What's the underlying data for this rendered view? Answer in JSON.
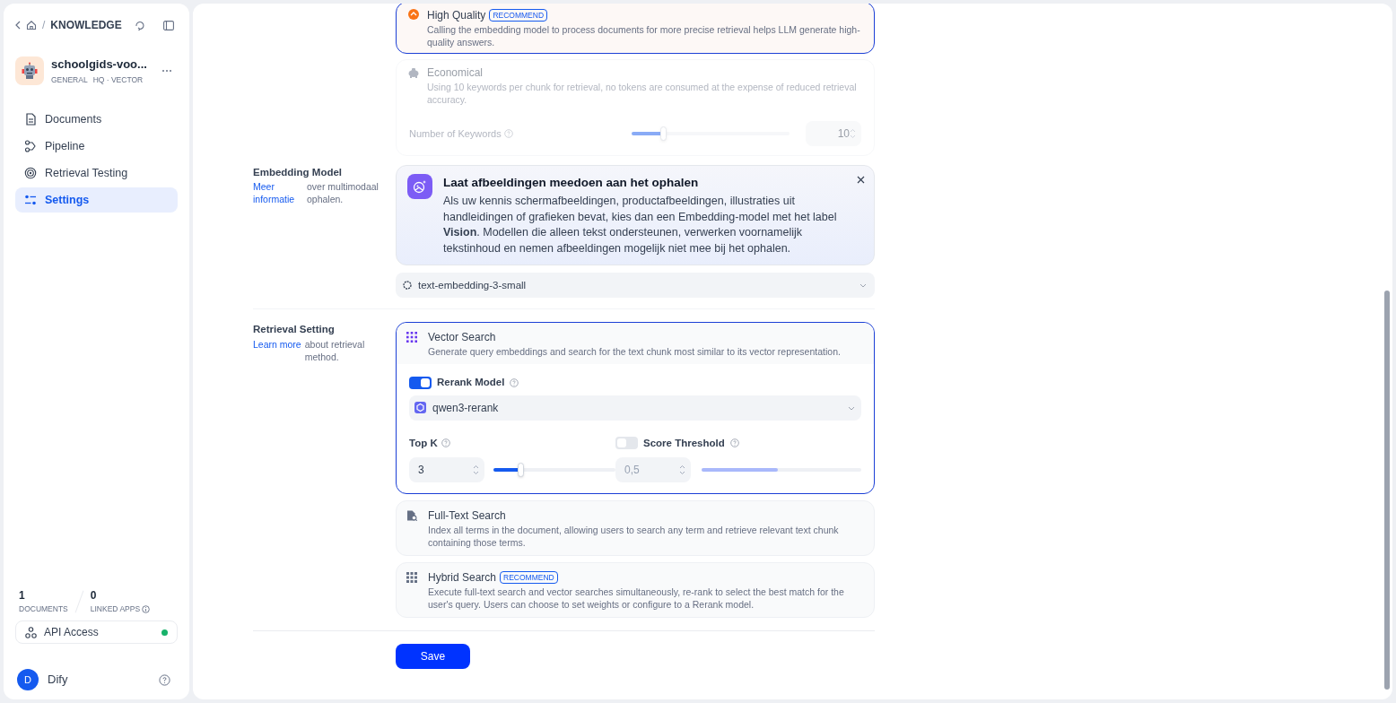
{
  "breadcrumb": {
    "separator": "/",
    "section": "KNOWLEDGE"
  },
  "dataset": {
    "name": "schoolgids-voo...",
    "tags": [
      "GENERAL",
      "HQ · VECTOR"
    ]
  },
  "nav": [
    {
      "kind": "documents",
      "label": "Documents",
      "selected": false
    },
    {
      "kind": "pipeline",
      "label": "Pipeline",
      "selected": false
    },
    {
      "kind": "testing",
      "label": "Retrieval Testing",
      "selected": false
    },
    {
      "kind": "settings",
      "label": "Settings",
      "selected": true
    }
  ],
  "stats": [
    {
      "value": "1",
      "label": "DOCUMENTS",
      "info": false
    },
    {
      "value": "0",
      "label": "LINKED APPS",
      "info": true
    }
  ],
  "api_access": {
    "label": "API Access",
    "on": true
  },
  "user": {
    "initial": "D",
    "name": "Dify"
  },
  "index_method": {
    "options": [
      {
        "kind": "high",
        "title": "High Quality",
        "badge": "RECOMMEND",
        "description": "Calling the embedding model to process documents for more precise retrieval helps LLM generate high-quality answers.",
        "selected": true
      },
      {
        "kind": "economical",
        "title": "Economical",
        "description": "Using 10 keywords per chunk for retrieval, no tokens are consumed at the expense of reduced retrieval accuracy.",
        "selected": false
      }
    ],
    "keywords": {
      "label": "Number of Keywords",
      "value": "10",
      "level": 0.2
    }
  },
  "embedding_model": {
    "label": "Embedding Model",
    "link": "Meer informatie",
    "note": "over multimodaal ophalen.",
    "banner": {
      "title": "Laat afbeeldingen meedoen aan het ophalen",
      "text": "Als uw kennis schermafbeeldingen, productafbeeldingen, illustraties uit handleidingen of grafieken bevat, kies dan een Embedding-model met het label **Vision**. Modellen die alleen tekst ondersteunen, verwerken voornamelijk tekstinhoud en nemen afbeeldingen mogelijk niet mee bij het ophalen."
    },
    "model": "text-embedding-3-small"
  },
  "retrieval": {
    "label": "Retrieval Setting",
    "link": "Learn more",
    "note": "about retrieval method.",
    "methods": [
      {
        "kind": "vector",
        "title": "Vector Search",
        "description": "Generate query embeddings and search for the text chunk most similar to its vector representation.",
        "selected": true
      },
      {
        "kind": "fulltext",
        "title": "Full-Text Search",
        "description": "Index all terms in the document, allowing users to search any term and retrieve relevant text chunk containing those terms.",
        "selected": false
      },
      {
        "kind": "hybrid",
        "title": "Hybrid Search",
        "badge": "RECOMMEND",
        "description": "Execute full-text search and vector searches simultaneously, re-rank to select the best match for the user's query. Users can choose to set weights or configure to a Rerank model.",
        "selected": false
      }
    ],
    "rerank": {
      "label": "Rerank Model",
      "on": true,
      "model": "qwen3-rerank"
    },
    "top_k": {
      "label": "Top K",
      "value": "3",
      "level": 0.22
    },
    "score_threshold": {
      "label": "Score Threshold",
      "on": false,
      "value": "0,5",
      "level": 0.48
    }
  },
  "save": "Save"
}
